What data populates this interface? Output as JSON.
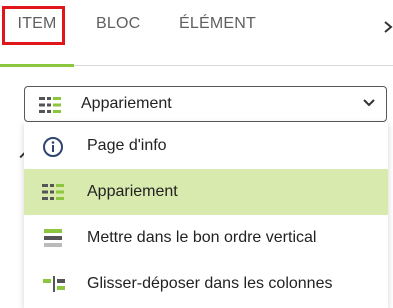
{
  "tabs": [
    {
      "label": "ITEM",
      "active": true
    },
    {
      "label": "BLOC",
      "active": false
    },
    {
      "label": "ÉLÉMENT",
      "active": false
    }
  ],
  "colors": {
    "accent": "#8cc63f",
    "highlight_box": "#e0161b",
    "selected_row": "#d8eaae"
  },
  "dropdown": {
    "selected_label": "Appariement",
    "selected_icon": "matching-list-icon",
    "options": [
      {
        "label": "Page d'info",
        "icon": "info-circle-icon",
        "selected": false
      },
      {
        "label": "Appariement",
        "icon": "matching-list-icon",
        "selected": true
      },
      {
        "label": "Mettre dans le bon ordre vertical",
        "icon": "vertical-order-icon",
        "selected": false
      },
      {
        "label": "Glisser-déposer dans les colonnes",
        "icon": "drag-columns-icon",
        "selected": false
      }
    ]
  }
}
